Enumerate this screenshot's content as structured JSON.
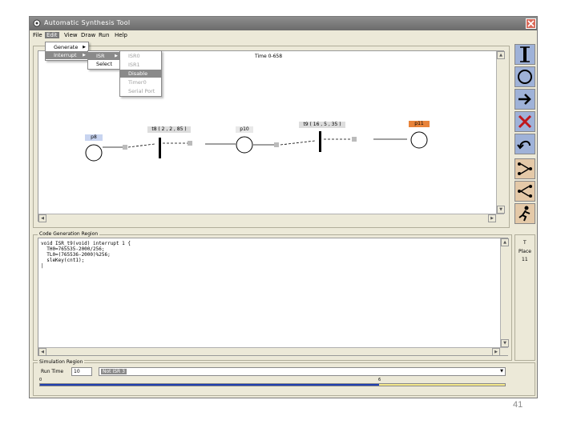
{
  "window": {
    "title": "Automatic Synthesis Tool"
  },
  "menubar": {
    "items": [
      "File",
      "Edit",
      "View",
      "Draw",
      "Run",
      "Help"
    ]
  },
  "edit_menu": {
    "items": [
      "Generate",
      "Interrupt"
    ]
  },
  "interrupt_submenu": {
    "items": [
      "ISR",
      "Select"
    ]
  },
  "isr_submenu": {
    "items": [
      "ISR0",
      "ISR1",
      "Disable",
      "Timer0",
      "Serial Port"
    ]
  },
  "canvas": {
    "time_label": "Time 0-658",
    "nodes": [
      {
        "label": "p8"
      },
      {
        "label": "p10"
      },
      {
        "label": "p11"
      }
    ],
    "transitions": [
      {
        "label": "t8 ( 2 , 2 , 85 )"
      },
      {
        "label": "t9 ( 16 , 5 , 35 )"
      }
    ]
  },
  "code_panel": {
    "title": "Code Generation Region",
    "lines": [
      "void ISR_t9(void) interrupt 1 {",
      "  TH0=765535-2000/256;",
      "  TL0=(765536-2000)%256;",
      "  sleKey(cnt1);",
      "|"
    ]
  },
  "right_info": {
    "line1": "T",
    "line2": "Place",
    "line3": "11"
  },
  "simulation": {
    "title": "Simulation Region",
    "run_time_label": "Run Time",
    "run_time_value": "10",
    "selected_transition": "Not ISR 3",
    "progress_start": "0",
    "progress_mid": "6",
    "progress_fraction": 0.73
  },
  "slide": {
    "page_number": "41"
  },
  "colors": {
    "selected_node": "#c8d4f0",
    "highlight_node": "#e8833a",
    "progress_blue": "#1f3fb0",
    "progress_yellow": "#f4e88a"
  },
  "toolbar": {
    "icons": [
      "vertical-bar-icon",
      "circle-icon",
      "arrow-right-icon",
      "delete-x-icon",
      "undo-arrow-icon",
      "hierarchy-icon",
      "merge-icon",
      "run-figure-icon"
    ]
  }
}
